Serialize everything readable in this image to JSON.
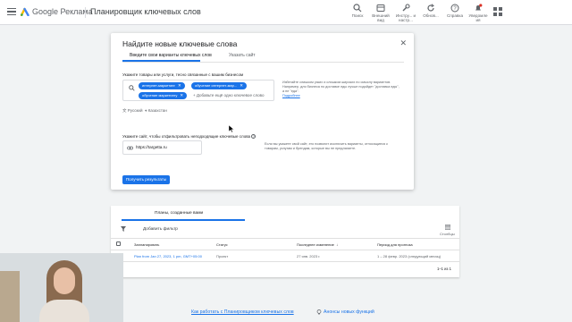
{
  "header": {
    "brand": "Google Реклама",
    "page_title": "Планировщик ключевых слов",
    "tools": [
      {
        "label": "Поиск",
        "icon": "search-icon"
      },
      {
        "label": "Внешний вид",
        "icon": "appearance-icon"
      },
      {
        "label": "Инстру... и настр...",
        "icon": "wrench-icon"
      },
      {
        "label": "Обнов...",
        "icon": "refresh-icon"
      },
      {
        "label": "Справка",
        "icon": "help-icon"
      },
      {
        "label": "Уведомле ия",
        "icon": "bell-icon"
      }
    ]
  },
  "modal": {
    "title": "Найдите новые ключевые слова",
    "tabs": [
      "Введите свои варианты ключевых слов",
      "Указать сайт"
    ],
    "keywords_label": "Укажите товары или услуги, тесно связанные с вашим бизнесом",
    "chips": [
      "интернет-маркетинг",
      "обучение интернет-мар...",
      "обучение маркетингу"
    ],
    "add_placeholder": "+ Добавьте ещё одно ключевое слово",
    "hint_text": "Избегайте слишком узких и слишком широких по смыслу вариантов. Например, для бизнеса по доставке еды лучше подойдет \"доставка еды\", а не \"еда\".",
    "hint_link": "Подробнее",
    "language": "Русский",
    "location": "Казахстан",
    "site_label": "Укажите сайт, чтобы отфильтровать неподходящие ключевые слова",
    "site_value": "https://targetta.ru",
    "site_hint": "Если вы укажете свой сайт, это позволит исключить варианты, относящиеся к товарам, услугам и брендам, которые вы не предлагаете.",
    "submit_label": "Получить результаты"
  },
  "plans": {
    "tab": "Планы, созданные вами",
    "add_filter": "Добавить фильтр",
    "columns_label": "Столбцы",
    "headers": [
      "Запланировать",
      "Статус",
      "Последнее изменение",
      "Период для прогноза"
    ],
    "rows": [
      {
        "plan": "Plan from Jan 27, 2023, 1 pm, GMT+05:00",
        "status": "Проект",
        "changed": "27 янв. 2023 г.",
        "period": "1 – 28 февр. 2023 (следующий месяц)"
      }
    ],
    "pager": "1–1 из 1"
  },
  "footer": {
    "link_left": "Как работать с Планировщиком ключевых слов",
    "link_right": "Анонсы новых функций"
  },
  "colors": {
    "accent": "#1a73e8",
    "text": "#202124",
    "muted": "#5f6368"
  }
}
